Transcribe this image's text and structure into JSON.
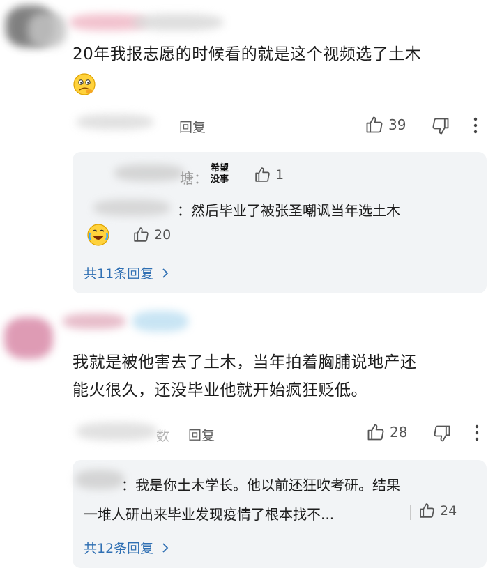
{
  "comments": [
    {
      "text_line1": "20年我报志愿的时候看的就是这个视频选了土木",
      "emoji_icon": "thinking-face-emoji",
      "reply_label": "回复",
      "like_count": "39",
      "replies": {
        "first": {
          "user_tail": "塘：",
          "sticker_text": "希望没事",
          "like_count": "1"
        },
        "second": {
          "text": "：然后毕业了被张圣嘲讽当年选土木",
          "emoji_icon": "laughing-crying-face-emoji",
          "like_count": "20"
        },
        "more_label": "共11条回复"
      }
    },
    {
      "text_line1": "我就是被他害去了土木，当年拍着胸脯说地产还",
      "text_line2": "能火很久，还没毕业他就开始疯狂贬低。",
      "user_tail": "数",
      "reply_label": "回复",
      "like_count": "28",
      "replies": {
        "first": {
          "line1": "：我是你土木学长。他以前还狂吹考研。结果",
          "line2": "一堆人研出来毕业发现疫情了根本找不...",
          "like_count": "24"
        },
        "more_label": "共12条回复"
      }
    }
  ],
  "colors": {
    "link": "#2f6fb3",
    "reply_bg": "#f2f4f6",
    "text": "#1c1c1c"
  }
}
